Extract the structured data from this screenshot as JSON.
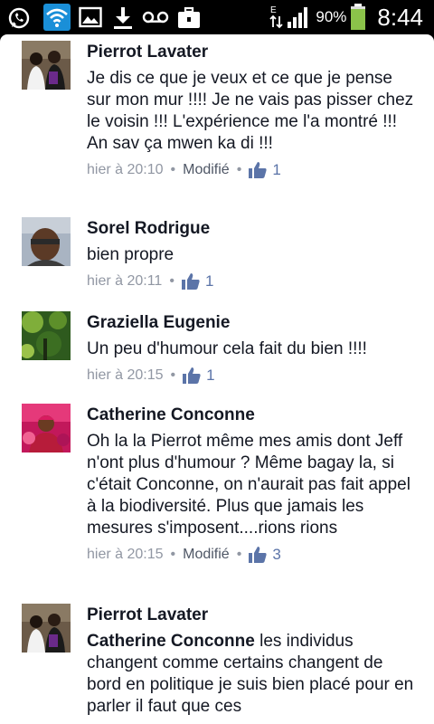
{
  "status_bar": {
    "battery": "90%",
    "time": "8:44",
    "icons": [
      "whatsapp-icon",
      "wifi-icon",
      "image-icon",
      "download-icon",
      "voicemail-icon",
      "briefcase-icon",
      "data-icon",
      "signal-icon",
      "battery-icon"
    ]
  },
  "comments": [
    {
      "author": "Pierrot Lavater",
      "mention": "",
      "text": "Je dis ce que je veux et ce que je pense  sur mon mur !!!! Je ne vais pas pisser chez le voisin !!! L'expérience me l'a montré !!! An sav ça mwen ka di !!!",
      "time": "hier à 20:10",
      "edited": "Modifié",
      "likes": "1"
    },
    {
      "author": "Sorel Rodrigue",
      "mention": "",
      "text": "bien propre",
      "time": "hier à 20:11",
      "edited": "",
      "likes": "1"
    },
    {
      "author": "Graziella Eugenie",
      "mention": "",
      "text": "Un peu d'humour cela fait du bien !!!!",
      "time": "hier à 20:15",
      "edited": "",
      "likes": "1"
    },
    {
      "author": "Catherine Conconne",
      "mention": "",
      "text": "Oh la la Pierrot  même mes amis dont Jeff  n'ont plus d'humour ? Même bagay la, si c'était Conconne, on n'aurait pas fait appel à la biodiversité. Plus  que jamais les mesures s'imposent....rions rions",
      "time": "hier à 20:15",
      "edited": "Modifié",
      "likes": "3"
    },
    {
      "author": "Pierrot Lavater",
      "mention": "Catherine Conconne",
      "text": " les individus changent comme certains changent de bord en politique je suis bien placé pour en parler il  faut que ces",
      "time": "",
      "edited": "",
      "likes": ""
    }
  ]
}
